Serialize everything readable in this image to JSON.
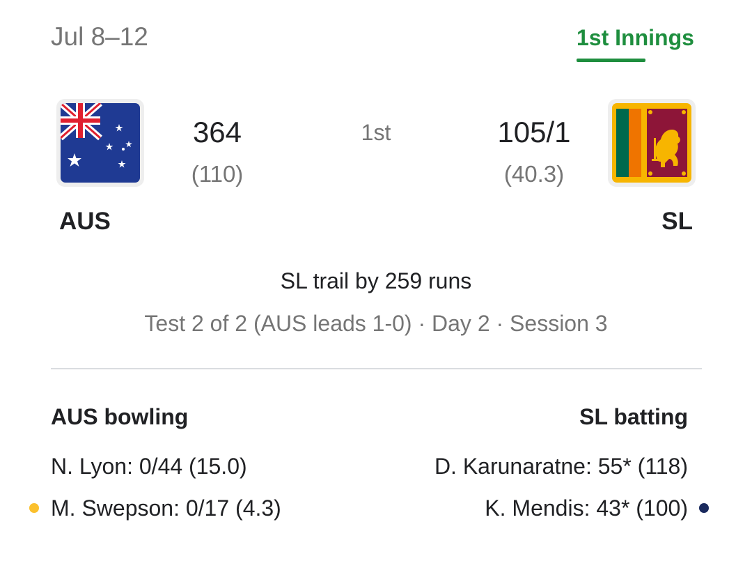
{
  "match": {
    "date": "Jul 8–12",
    "innings_tab": "1st Innings",
    "innings_indicator": "1st",
    "status": "SL trail by 259 runs",
    "series": "Test 2 of 2 (AUS leads 1-0) · Day 2 · Session 3"
  },
  "team1": {
    "name": "AUS",
    "score": "364",
    "overs": "(110)",
    "flag": "australia-flag-icon"
  },
  "team2": {
    "name": "SL",
    "score": "105/1",
    "overs": "(40.3)",
    "flag": "sri-lanka-flag-icon"
  },
  "bowling": {
    "heading": "AUS bowling",
    "players": [
      {
        "line": "N. Lyon: 0/44 (15.0)"
      },
      {
        "line": "M. Swepson: 0/17 (4.3)"
      }
    ]
  },
  "batting": {
    "heading": "SL batting",
    "players": [
      {
        "line": "D. Karunaratne: 55* (118)"
      },
      {
        "line": "K. Mendis: 43* (100)"
      }
    ]
  },
  "colors": {
    "accent": "#1e8e3e",
    "bowler_marker": "#fbc02d",
    "batter_marker": "#1a2a5e"
  }
}
